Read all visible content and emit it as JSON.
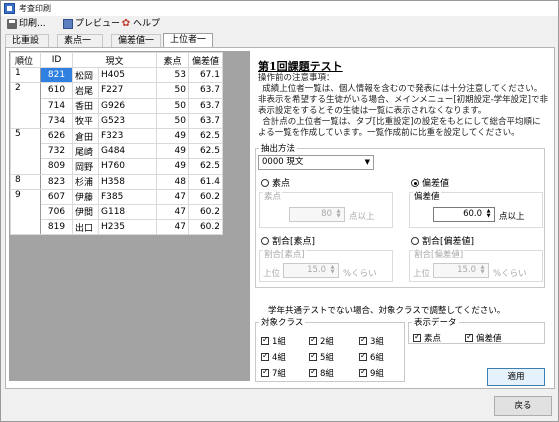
{
  "window": {
    "title": "考査印刷"
  },
  "menu": {
    "print": "印刷...",
    "preview": "プレビュー",
    "help": "ヘルプ"
  },
  "tabs": [
    "比重設定",
    "素点一覧",
    "偏差値一覧",
    "上位者一覧"
  ],
  "active_tab": 3,
  "table": {
    "headers": [
      "順位",
      "ID",
      "現文",
      "素点",
      "偏差値"
    ],
    "rows": [
      {
        "rank": "1",
        "id": "821",
        "name": "松岡",
        "gen": "H405",
        "score": "53",
        "dev": "67.1"
      },
      {
        "rank": "2",
        "id": "610",
        "name": "岩尾",
        "gen": "F227",
        "score": "50",
        "dev": "63.7"
      },
      {
        "rank": "",
        "id": "714",
        "name": "香田",
        "gen": "G926",
        "score": "50",
        "dev": "63.7"
      },
      {
        "rank": "",
        "id": "734",
        "name": "牧平",
        "gen": "G523",
        "score": "50",
        "dev": "63.7"
      },
      {
        "rank": "5",
        "id": "626",
        "name": "倉田",
        "gen": "F323",
        "score": "49",
        "dev": "62.5"
      },
      {
        "rank": "",
        "id": "732",
        "name": "尾崎",
        "gen": "G484",
        "score": "49",
        "dev": "62.5"
      },
      {
        "rank": "",
        "id": "809",
        "name": "岡野",
        "gen": "H760",
        "score": "49",
        "dev": "62.5"
      },
      {
        "rank": "8",
        "id": "823",
        "name": "杉浦",
        "gen": "H358",
        "score": "48",
        "dev": "61.4"
      },
      {
        "rank": "9",
        "id": "607",
        "name": "伊藤",
        "gen": "F385",
        "score": "47",
        "dev": "60.2"
      },
      {
        "rank": "",
        "id": "706",
        "name": "伊間",
        "gen": "G118",
        "score": "47",
        "dev": "60.2"
      },
      {
        "rank": "",
        "id": "819",
        "name": "出口",
        "gen": "H235",
        "score": "47",
        "dev": "60.2"
      }
    ]
  },
  "right": {
    "heading": "第1回課題テスト",
    "note_title": "操作前の注意事項：",
    "note_p1": "成績上位者一覧は、個人情報を含むので発表には十分注意してください。非表示を希望する生徒がいる場合、メインメニュー[初期設定-学年設定]で非表示設定をするとその生徒は一覧に表示されなくなります。",
    "note_p2": "合計点の上位者一覧は、タブ[比重設定]の設定をもとにして総合平均順による一覧を作成しています。一覧作成前に比重を設定してください。",
    "extract_label": "抽出方法",
    "select_value": "0000 現文",
    "radio_score": "素点",
    "radio_dev": "偏差値",
    "score_sub_label": "素点",
    "score_value": "80",
    "score_suffix": "点以上",
    "dev_sub_label": "偏差値",
    "dev_value": "60.0",
    "dev_suffix": "点以上",
    "radio_ratio_score": "割合[素点]",
    "radio_ratio_dev": "割合[偏差値]",
    "ratio_score_sub": "割合[素点]",
    "ratio_dev_sub": "割合[偏差値]",
    "top_label": "上位",
    "ratio_value": "15.0",
    "ratio_suffix": "%くらい",
    "ratio_suffix2": "%くらい",
    "class_note": "学年共通テストでない場合、対象クラスで調整してください。",
    "class_label": "対象クラス",
    "classes": [
      "1組",
      "2組",
      "3組",
      "4組",
      "5組",
      "6組",
      "7組",
      "8組",
      "9組"
    ],
    "display_label": "表示データ",
    "display_items": [
      "素点",
      "偏差値"
    ],
    "apply_button": "適用"
  },
  "footer": {
    "back_button": "戻る"
  }
}
